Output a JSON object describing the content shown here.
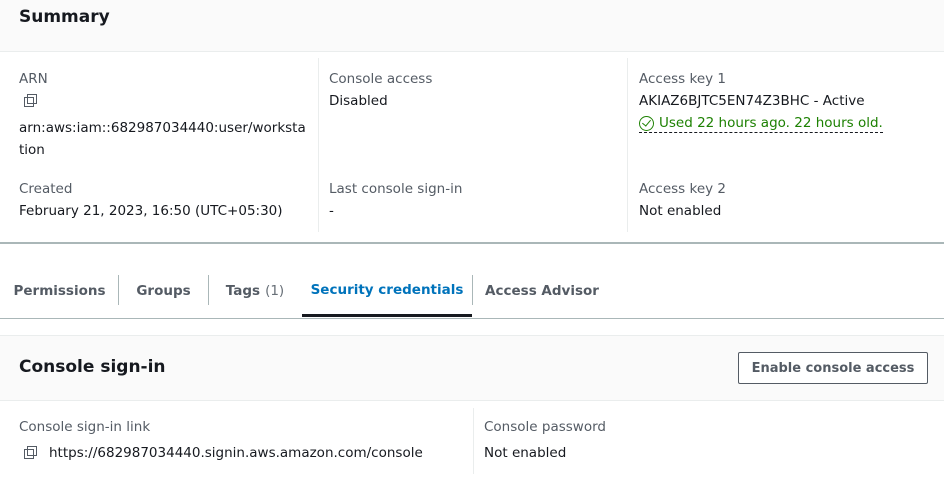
{
  "summary": {
    "title": "Summary",
    "arn_label": "ARN",
    "arn_value": "arn:aws:iam::682987034440:user/workstation",
    "created_label": "Created",
    "created_value": "February 21, 2023, 16:50 (UTC+05:30)",
    "console_access_label": "Console access",
    "console_access_value": "Disabled",
    "last_signin_label": "Last console sign-in",
    "last_signin_value": "-",
    "access_key1_label": "Access key 1",
    "access_key1_value": "AKIAZ6BJTC5EN74Z3BHC - Active",
    "access_key1_status": "Used 22 hours ago. 22 hours old.",
    "access_key2_label": "Access key 2",
    "access_key2_value": "Not enabled"
  },
  "tabs": [
    {
      "label": "Permissions"
    },
    {
      "label": "Groups"
    },
    {
      "label": "Tags",
      "count": "(1)"
    },
    {
      "label": "Security credentials",
      "active": true
    },
    {
      "label": "Access Advisor"
    }
  ],
  "console_signin": {
    "title": "Console sign-in",
    "enable_button": "Enable console access",
    "link_label": "Console sign-in link",
    "link_value": "https://682987034440.signin.aws.amazon.com/console",
    "password_label": "Console password",
    "password_value": "Not enabled"
  },
  "colors": {
    "accent": "#0073bb",
    "success": "#1d8102",
    "text": "#16191f",
    "muted": "#545b64"
  }
}
